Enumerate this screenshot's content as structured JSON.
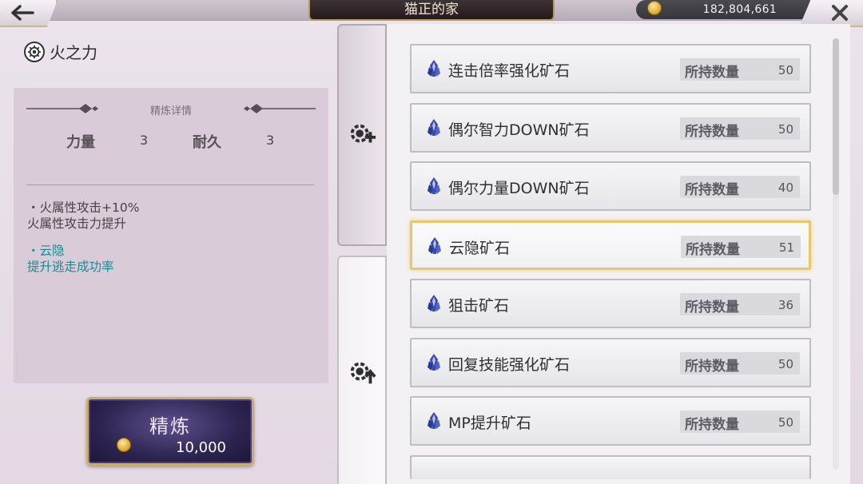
{
  "header": {
    "title": "猫正的家",
    "currency_amount": "182,804,661",
    "back_icon": "arrow-left-icon",
    "close_icon": "close-icon"
  },
  "skill": {
    "name": "火之力",
    "details_heading": "精炼详情",
    "stats": [
      {
        "label": "力量",
        "value": "3"
      },
      {
        "label": "耐久",
        "value": "3"
      }
    ],
    "effects": [
      {
        "line1": "・火属性攻击+10%",
        "line2": "火属性攻击力提升"
      },
      {
        "line1": "・云隐",
        "line2": "提升逃走成功率"
      }
    ]
  },
  "refine_button": {
    "label": "精炼",
    "cost": "10,000"
  },
  "tabs": [
    {
      "icon": "gear-plus-icon",
      "active": false
    },
    {
      "icon": "gear-up-arrow-icon",
      "active": true
    }
  ],
  "ore_list": {
    "qty_label": "所持数量",
    "items": [
      {
        "name": "连击倍率强化矿石",
        "qty": "50",
        "selected": false
      },
      {
        "name": "偶尔智力DOWN矿石",
        "qty": "50",
        "selected": false
      },
      {
        "name": "偶尔力量DOWN矿石",
        "qty": "40",
        "selected": false
      },
      {
        "name": "云隐矿石",
        "qty": "51",
        "selected": true
      },
      {
        "name": "狙击矿石",
        "qty": "36",
        "selected": false
      },
      {
        "name": "回复技能强化矿石",
        "qty": "50",
        "selected": false
      },
      {
        "name": "MP提升矿石",
        "qty": "50",
        "selected": false
      }
    ]
  },
  "colors": {
    "accent_gold": "#c7ae6a",
    "effect_teal": "#1a8a93",
    "selected_border": "#e6c76b"
  }
}
